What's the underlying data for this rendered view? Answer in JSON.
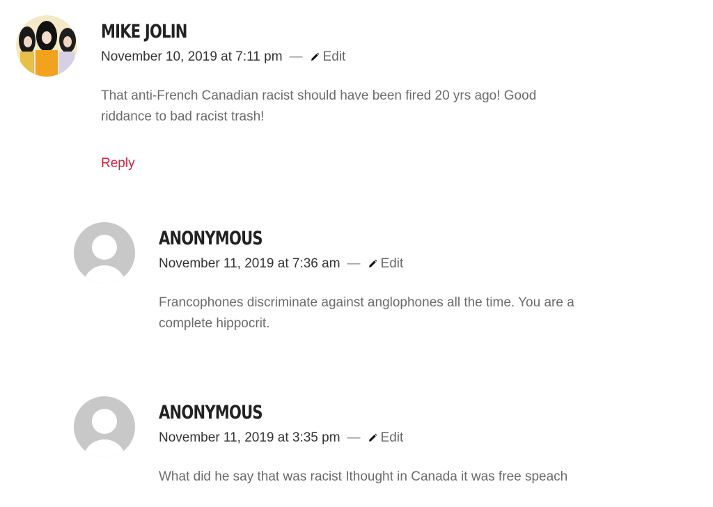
{
  "comments": [
    {
      "author": "MIKE JOLIN",
      "date": "November 10, 2019 at 7:11 pm",
      "separator": "—",
      "edit_label": "Edit",
      "text": "That anti-French Canadian racist should have been fired 20 yrs ago! Good riddance to bad racist trash!",
      "reply_label": "Reply",
      "avatar": "photo-avatar"
    },
    {
      "author": "ANONYMOUS",
      "date": "November 11, 2019 at 7:36 am",
      "separator": "—",
      "edit_label": "Edit",
      "text": "Francophones discriminate against anglophones all the time. You are a complete hippocrit.",
      "avatar": "default-user-icon"
    },
    {
      "author": "ANONYMOUS",
      "date": "November 11, 2019 at 3:35 pm",
      "separator": "—",
      "edit_label": "Edit",
      "text": "What did he say that was racist Ithought in Canada it was free speach",
      "avatar": "default-user-icon"
    }
  ],
  "colors": {
    "reply_link": "#d4213f",
    "author": "#222222",
    "body_text": "#6b6b6b",
    "avatar_placeholder": "#c8c8c8"
  }
}
